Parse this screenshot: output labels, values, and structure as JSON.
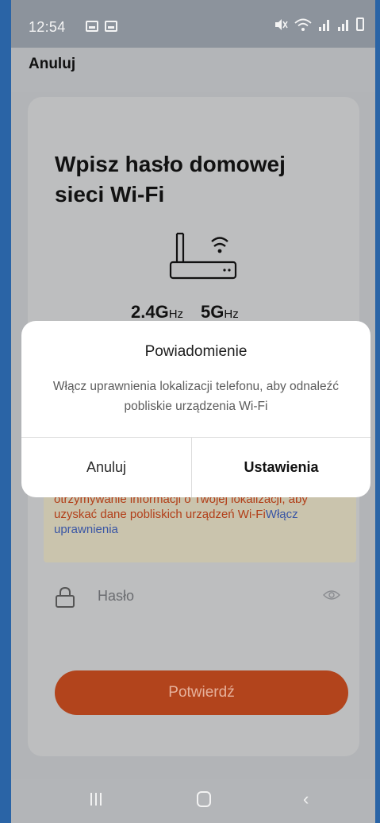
{
  "status_bar": {
    "time": "12:54",
    "left_icons": [
      "image-icon",
      "message-icon"
    ],
    "right_icons": [
      "mute-icon",
      "wifi-icon",
      "signal-icon",
      "signal-icon",
      "battery-charging-icon"
    ]
  },
  "header": {
    "cancel_label": "Anuluj"
  },
  "page": {
    "title": "Wpisz hasło domowej sieci Wi-Fi",
    "router_icon": "router-wifi-icon",
    "freq_24_value": "2.4G",
    "freq_24_unit": "Hz",
    "freq_5_value": "5G",
    "freq_5_unit": "Hz",
    "warning_text": "Wpisz ręcznie nazwę sieci Wi-Fi lub zezwól na otrzymywanie informacji o Twojej lokalizacji, aby uzyskać dane pobliskich urządzeń Wi-Fi",
    "warning_link": "Włącz uprawnienia",
    "password_placeholder": "Hasło",
    "confirm_label": "Potwierdź"
  },
  "dialog": {
    "title": "Powiadomienie",
    "message": "Włącz uprawnienia lokalizacji telefonu, aby odnaleźć pobliskie urządzenia Wi-Fi",
    "cancel_label": "Anuluj",
    "settings_label": "Ustawienia"
  },
  "nav": {
    "recent": "recent-apps-icon",
    "home": "home-icon",
    "back": "back-icon"
  },
  "colors": {
    "accent_button": "#b2441c",
    "warning_text": "#b23e18",
    "link": "#3a56a5",
    "dim_overlay_bg": "#b2b4b7"
  }
}
